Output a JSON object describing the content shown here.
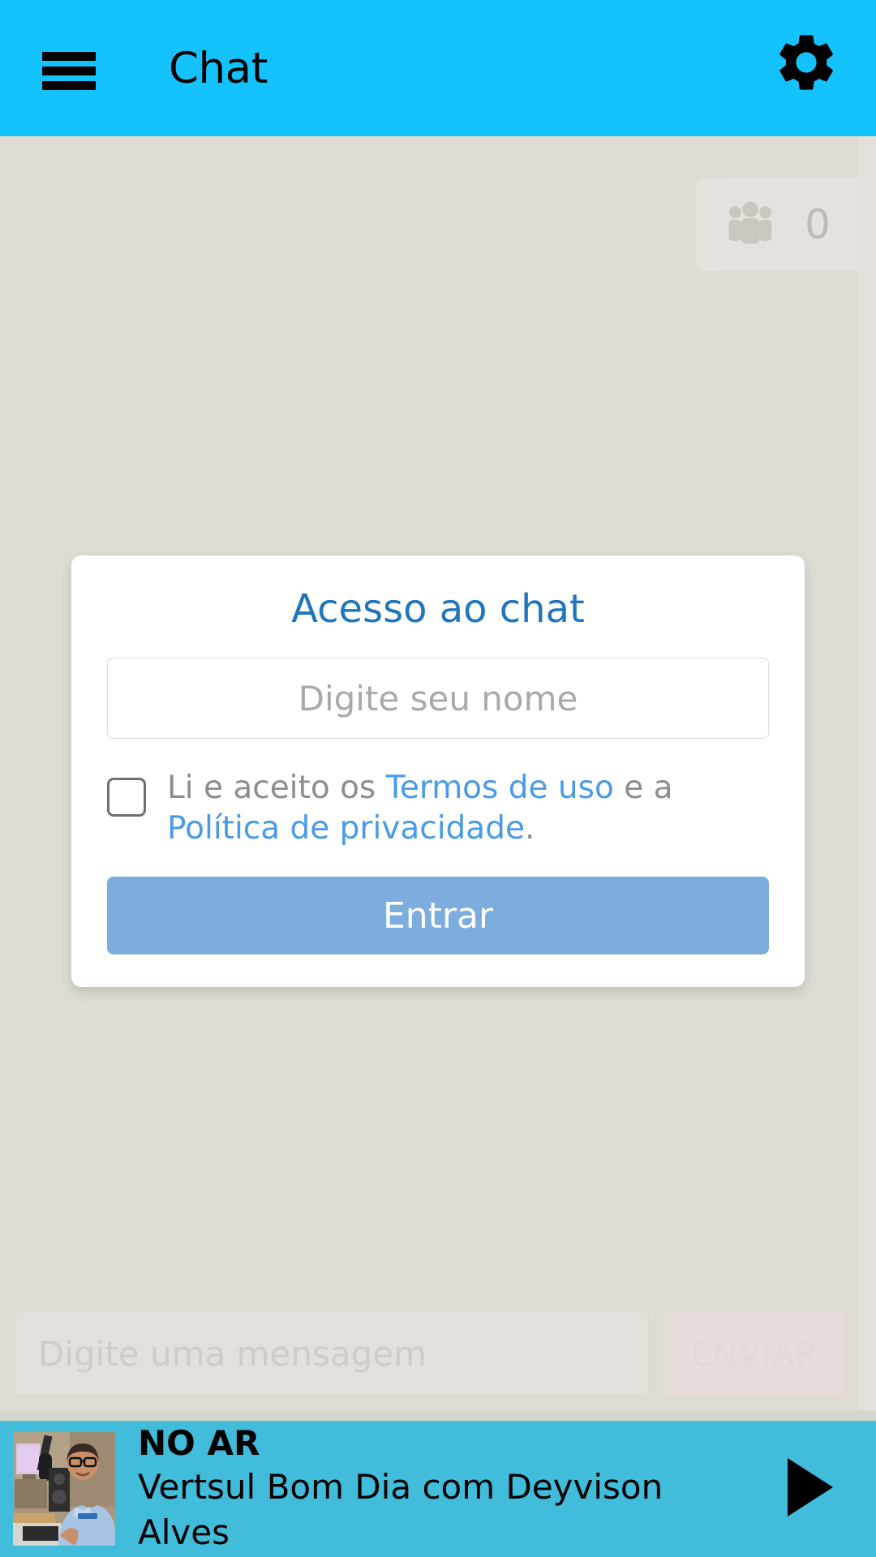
{
  "header": {
    "menu_icon": "hamburger-menu-icon",
    "title": "Chat",
    "settings_icon": "gear-icon",
    "background_color": "#14c3fd"
  },
  "chat": {
    "online_badge": {
      "icon": "people-group-icon",
      "count": "0"
    },
    "background_color": "#dedad4"
  },
  "modal": {
    "title": "Acesso ao chat",
    "title_color": "#2175ba",
    "name_input": {
      "placeholder": "Digite seu nome",
      "value": ""
    },
    "terms": {
      "prefix": "Li e aceito os ",
      "terms_link": "Termos de uso",
      "middle": " e a ",
      "privacy_link": "Política de privacidade",
      "suffix": ".",
      "checkbox_checked": false,
      "link_color": "#4a9ae8"
    },
    "submit_label": "Entrar",
    "submit_color": "#7cadde"
  },
  "composer": {
    "placeholder": "Digite uma mensagem",
    "value": "",
    "send_label": "ENVIAR"
  },
  "player": {
    "live_label": "NO AR",
    "program": "Vertsul Bom Dia com Deyvison Alves",
    "play_icon": "play-triangle-icon",
    "background_color": "#41bcdb",
    "thumbnail_alt": "radio-studio-host-photo"
  }
}
